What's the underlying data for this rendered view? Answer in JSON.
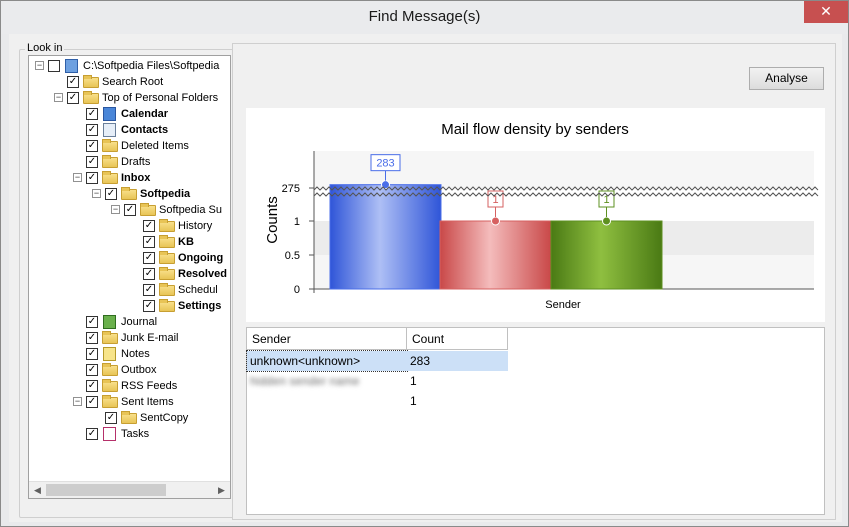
{
  "window": {
    "title": "Find Message(s)",
    "close_glyph": "✕"
  },
  "lookin": {
    "legend": "Look in",
    "tree": [
      {
        "label": "C:\\Softpedia Files\\Softpedia",
        "depth": 0,
        "expander": "minus",
        "checked": false,
        "icon": "pst-store-icon",
        "bold": false
      },
      {
        "label": "Search Root",
        "depth": 1,
        "expander": "",
        "checked": true,
        "icon": "folder-icon",
        "bold": false
      },
      {
        "label": "Top of Personal Folders",
        "depth": 1,
        "expander": "minus",
        "checked": true,
        "icon": "folder-icon",
        "bold": false
      },
      {
        "label": "Calendar",
        "depth": 2,
        "expander": "",
        "checked": true,
        "icon": "calendar-icon",
        "bold": true
      },
      {
        "label": "Contacts",
        "depth": 2,
        "expander": "",
        "checked": true,
        "icon": "contacts-icon",
        "bold": true
      },
      {
        "label": "Deleted Items",
        "depth": 2,
        "expander": "",
        "checked": true,
        "icon": "folder-icon",
        "bold": false
      },
      {
        "label": "Drafts",
        "depth": 2,
        "expander": "",
        "checked": true,
        "icon": "folder-icon",
        "bold": false
      },
      {
        "label": "Inbox",
        "depth": 2,
        "expander": "minus",
        "checked": true,
        "icon": "folder-icon",
        "bold": true
      },
      {
        "label": "Softpedia",
        "depth": 3,
        "expander": "minus",
        "checked": true,
        "icon": "folder-icon",
        "bold": true
      },
      {
        "label": "Softpedia Su",
        "depth": 4,
        "expander": "minus",
        "checked": true,
        "icon": "folder-icon",
        "bold": false
      },
      {
        "label": "History",
        "depth": 5,
        "expander": "",
        "checked": true,
        "icon": "folder-icon",
        "bold": false
      },
      {
        "label": "KB",
        "depth": 5,
        "expander": "",
        "checked": true,
        "icon": "folder-icon",
        "bold": true
      },
      {
        "label": "Ongoing",
        "depth": 5,
        "expander": "",
        "checked": true,
        "icon": "folder-icon",
        "bold": true
      },
      {
        "label": "Resolved",
        "depth": 5,
        "expander": "",
        "checked": true,
        "icon": "folder-icon",
        "bold": true
      },
      {
        "label": "Schedul",
        "depth": 5,
        "expander": "",
        "checked": true,
        "icon": "folder-icon",
        "bold": false
      },
      {
        "label": "Settings",
        "depth": 5,
        "expander": "",
        "checked": true,
        "icon": "folder-icon",
        "bold": true
      },
      {
        "label": "Journal",
        "depth": 2,
        "expander": "",
        "checked": true,
        "icon": "journal-icon",
        "bold": false
      },
      {
        "label": "Junk E-mail",
        "depth": 2,
        "expander": "",
        "checked": true,
        "icon": "folder-icon",
        "bold": false
      },
      {
        "label": "Notes",
        "depth": 2,
        "expander": "",
        "checked": true,
        "icon": "notes-icon",
        "bold": false
      },
      {
        "label": "Outbox",
        "depth": 2,
        "expander": "",
        "checked": true,
        "icon": "folder-icon",
        "bold": false
      },
      {
        "label": "RSS Feeds",
        "depth": 2,
        "expander": "",
        "checked": true,
        "icon": "folder-icon",
        "bold": false
      },
      {
        "label": "Sent Items",
        "depth": 2,
        "expander": "minus",
        "checked": true,
        "icon": "folder-icon",
        "bold": false
      },
      {
        "label": "SentCopy",
        "depth": 3,
        "expander": "",
        "checked": true,
        "icon": "folder-icon",
        "bold": false
      },
      {
        "label": "Tasks",
        "depth": 2,
        "expander": "",
        "checked": true,
        "icon": "tasks-icon",
        "bold": false
      }
    ],
    "scroll_left": "◀",
    "scroll_right": "▶"
  },
  "toolbar": {
    "analyse_label": "Analyse"
  },
  "chart_data": {
    "type": "bar",
    "title": "Mail flow density by senders",
    "xlabel": "Sender",
    "ylabel": "Counts",
    "axis_break": true,
    "y_ticks": [
      0,
      0.5,
      1,
      275
    ],
    "categories": [
      "unknown<unknown>",
      "",
      ""
    ],
    "values": [
      283,
      1,
      1
    ],
    "data_labels": [
      "283",
      "1",
      "1"
    ],
    "colors": [
      "#4a6ee8",
      "#d66060",
      "#5e9020"
    ],
    "grid": true
  },
  "results": {
    "columns": [
      "Sender",
      "Count"
    ],
    "rows": [
      {
        "sender": "unknown<unknown>",
        "count": "283",
        "selected": true,
        "blurred": false
      },
      {
        "sender": "hidden sender name",
        "count": "1",
        "selected": false,
        "blurred": true
      },
      {
        "sender": "",
        "count": "1",
        "selected": false,
        "blurred": false
      }
    ]
  }
}
